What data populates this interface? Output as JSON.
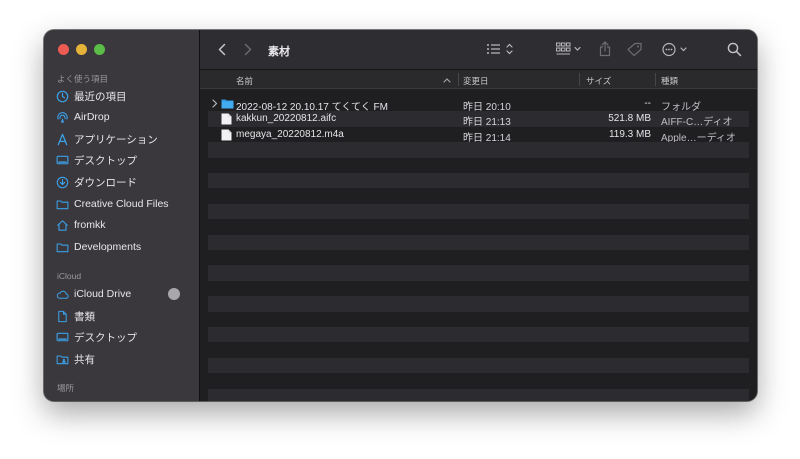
{
  "sidebar": {
    "favorites_title": "よく使う項目",
    "favorites": [
      {
        "label": "最近の項目",
        "icon": "clock-icon"
      },
      {
        "label": "AirDrop",
        "icon": "airdrop-icon"
      },
      {
        "label": "アプリケーション",
        "icon": "applications-icon"
      },
      {
        "label": "デスクトップ",
        "icon": "desktop-icon"
      },
      {
        "label": "ダウンロード",
        "icon": "download-icon"
      },
      {
        "label": "Creative Cloud Files",
        "icon": "folder-icon"
      },
      {
        "label": "fromkk",
        "icon": "home-icon"
      },
      {
        "label": "Developments",
        "icon": "folder-icon"
      }
    ],
    "icloud_title": "iCloud",
    "icloud": [
      {
        "label": "iCloud Drive",
        "icon": "cloud-icon"
      },
      {
        "label": "書類",
        "icon": "document-icon"
      },
      {
        "label": "デスクトップ",
        "icon": "desktop-icon"
      },
      {
        "label": "共有",
        "icon": "shared-folder-icon"
      }
    ],
    "locations_title": "場所"
  },
  "toolbar": {
    "title": "素材"
  },
  "columns": {
    "name": "名前",
    "modified": "変更日",
    "size": "サイズ",
    "kind": "種類"
  },
  "files": [
    {
      "name": "2022-08-12 20.10.17 てくてく FM",
      "modified": "昨日 20:10",
      "size": "--",
      "kind": "フォルダ",
      "type": "folder"
    },
    {
      "name": "kakkun_20220812.aifc",
      "modified": "昨日 21:13",
      "size": "521.8 MB",
      "kind": "AIFF-C…ディオ",
      "type": "file"
    },
    {
      "name": "megaya_20220812.m4a",
      "modified": "昨日 21:14",
      "size": "119.3 MB",
      "kind": "Apple…ーディオ",
      "type": "file"
    }
  ],
  "colors": {
    "accent": "#3ba1e8",
    "close": "#ee5b52",
    "minimize": "#e5b33a",
    "maximize": "#5bbd47"
  }
}
